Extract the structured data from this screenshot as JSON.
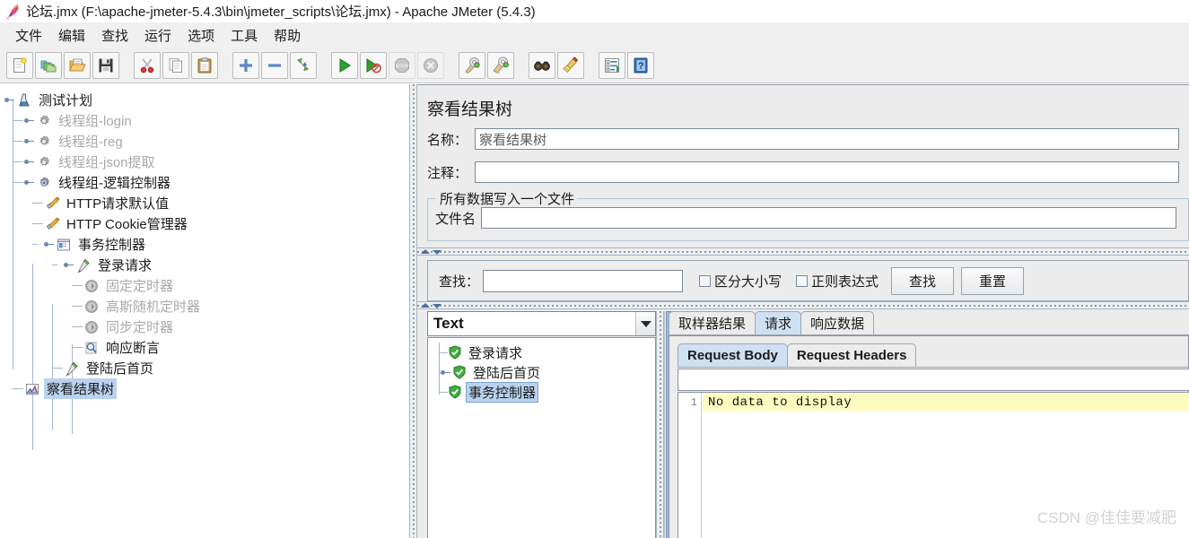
{
  "window": {
    "title": "论坛.jmx (F:\\apache-jmeter-5.4.3\\bin\\jmeter_scripts\\论坛.jmx) - Apache JMeter (5.4.3)",
    "app_icon": "jmeter-feather-icon"
  },
  "menubar": {
    "items": [
      {
        "label": "文件",
        "name": "menu-file"
      },
      {
        "label": "编辑",
        "name": "menu-edit"
      },
      {
        "label": "查找",
        "name": "menu-search"
      },
      {
        "label": "运行",
        "name": "menu-run"
      },
      {
        "label": "选项",
        "name": "menu-options"
      },
      {
        "label": "工具",
        "name": "menu-tools"
      },
      {
        "label": "帮助",
        "name": "menu-help"
      }
    ]
  },
  "toolbar": {
    "groups": [
      [
        "new-icon",
        "templates-icon",
        "open-icon",
        "save-icon"
      ],
      [
        "cut-icon",
        "copy-icon",
        "paste-icon"
      ],
      [
        "expand-icon",
        "collapse-icon",
        "toggle-icon"
      ],
      [
        "start-icon",
        "start-no-pauses-icon",
        "stop-icon",
        "shutdown-icon"
      ],
      [
        "clear-icon",
        "clear-all-icon"
      ],
      [
        "search-icon",
        "search-reset-icon"
      ],
      [
        "function-helper-icon",
        "help-icon"
      ]
    ]
  },
  "tree": {
    "nodes": [
      {
        "label": "测试计划",
        "icon": "test-plan-icon",
        "depth": 0,
        "state": "normal",
        "handle": "expanded"
      },
      {
        "label": "线程组-login",
        "icon": "thread-group-icon",
        "depth": 1,
        "state": "disabled",
        "handle": "collapsed"
      },
      {
        "label": "线程组-reg",
        "icon": "thread-group-icon",
        "depth": 1,
        "state": "disabled",
        "handle": "collapsed"
      },
      {
        "label": "线程组-json提取",
        "icon": "thread-group-icon",
        "depth": 1,
        "state": "disabled",
        "handle": "collapsed"
      },
      {
        "label": "线程组-逻辑控制器",
        "icon": "thread-group-active-icon",
        "depth": 1,
        "state": "normal",
        "handle": "expanded"
      },
      {
        "label": "HTTP请求默认值",
        "icon": "config-element-icon",
        "depth": 2,
        "state": "normal",
        "handle": "leaf"
      },
      {
        "label": "HTTP Cookie管理器",
        "icon": "config-element-icon",
        "depth": 2,
        "state": "normal",
        "handle": "leaf"
      },
      {
        "label": "事务控制器",
        "icon": "transaction-controller-icon",
        "depth": 2,
        "state": "normal",
        "handle": "expanded"
      },
      {
        "label": "登录请求",
        "icon": "http-sampler-icon",
        "depth": 3,
        "state": "normal",
        "handle": "expanded"
      },
      {
        "label": "固定定时器",
        "icon": "timer-icon",
        "depth": 4,
        "state": "disabled",
        "handle": "leaf"
      },
      {
        "label": "高斯随机定时器",
        "icon": "timer-icon",
        "depth": 4,
        "state": "disabled",
        "handle": "leaf"
      },
      {
        "label": "同步定时器",
        "icon": "timer-icon",
        "depth": 4,
        "state": "disabled",
        "handle": "leaf"
      },
      {
        "label": "响应断言",
        "icon": "assertion-icon",
        "depth": 4,
        "state": "normal",
        "handle": "leaf"
      },
      {
        "label": "登陆后首页",
        "icon": "http-sampler-icon",
        "depth": 3,
        "state": "normal",
        "handle": "leaf"
      },
      {
        "label": "察看结果树",
        "icon": "view-results-tree-icon",
        "depth": 2,
        "state": "selected",
        "handle": "leaf"
      }
    ]
  },
  "right_panel": {
    "title": "察看结果树",
    "name_label": "名称：",
    "name_value": "察看结果树",
    "comment_label": "注释：",
    "comment_value": "",
    "file_group_title": "所有数据写入一个文件",
    "filename_label": "文件名",
    "filename_value": "",
    "search": {
      "label": "查找：",
      "value": "",
      "case_sensitive_label": "区分大小写",
      "case_sensitive_checked": false,
      "regex_label": "正则表达式",
      "regex_checked": false,
      "find_button": "查找",
      "reset_button": "重置"
    },
    "renderer": {
      "selected": "Text",
      "options": [
        "Text"
      ]
    },
    "results": [
      {
        "label": "登录请求",
        "status": "success",
        "selected": false,
        "handle": "leaf"
      },
      {
        "label": "登陆后首页",
        "status": "success",
        "selected": false,
        "handle": "expanded"
      },
      {
        "label": "事务控制器",
        "status": "success",
        "selected": true,
        "handle": "leaf"
      }
    ],
    "tabs": [
      {
        "label": "取样器结果",
        "active": false,
        "name": "tab-sampler-result"
      },
      {
        "label": "请求",
        "active": true,
        "name": "tab-request"
      },
      {
        "label": "响应数据",
        "active": false,
        "name": "tab-response-data"
      }
    ],
    "subtabs": [
      {
        "label": "Request Body",
        "active": true,
        "name": "subtab-request-body"
      },
      {
        "label": "Request Headers",
        "active": false,
        "name": "subtab-request-headers"
      }
    ],
    "search_field_value": "",
    "code": {
      "line_number": "1",
      "text": "No data to display"
    }
  },
  "watermark": "CSDN @佳佳要减肥",
  "colors": {
    "selection": "#b9d2ef",
    "active_tab": "#cfe0f2",
    "panel_bg": "#ececec",
    "code_highlight": "#fdfcbe",
    "disabled_text": "#a9a9a9",
    "tree_line": "#9fb6d0"
  }
}
